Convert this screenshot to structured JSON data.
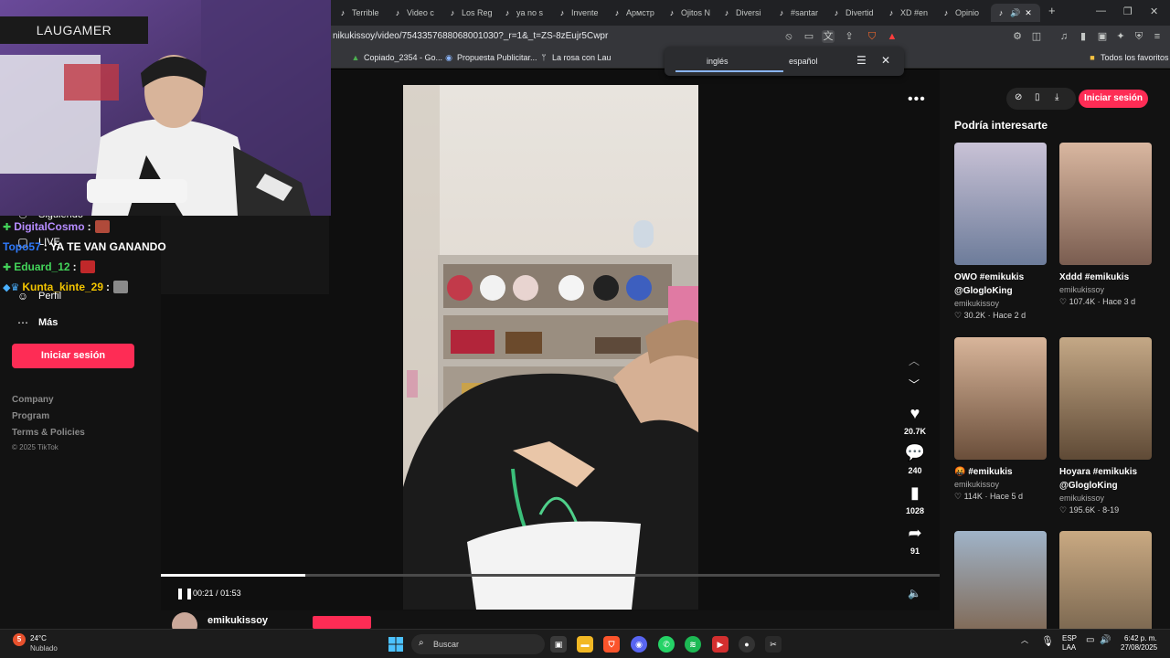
{
  "browser": {
    "tabs": [
      {
        "label": "Terrible"
      },
      {
        "label": "Video c"
      },
      {
        "label": "Los Reg"
      },
      {
        "label": "ya no s"
      },
      {
        "label": "Invente"
      },
      {
        "label": "Армстр"
      },
      {
        "label": "Ojitos N"
      },
      {
        "label": "Diversi"
      },
      {
        "label": "#santar"
      },
      {
        "label": "Divertid"
      },
      {
        "label": "XD #en"
      },
      {
        "label": "Opinio"
      }
    ],
    "new_tab_label": "+",
    "url": "nikukissoy/video/7543357688068001030?_r=1&_t=ZS-8zEujr5Cwpr",
    "bookmarks": [
      {
        "label": "Copiado_2354 - Go..."
      },
      {
        "label": "Propuesta Publicitar..."
      },
      {
        "label": "La rosa con Lau"
      }
    ],
    "bookmarks_right": "Todos los favoritos",
    "translate": {
      "option_1": "inglés",
      "option_2": "español"
    }
  },
  "overlay": {
    "cam_label": "LAUGAMER",
    "chat": [
      {
        "user": "DigitalCosmo",
        "sep": ":",
        "msg": "",
        "badge": "✚",
        "user_color": "#b68cff",
        "badge_color": "#43d45a"
      },
      {
        "user": "Topo57",
        "sep": ":",
        "msg": "YA TE VAN GANANDO",
        "badge": "",
        "user_color": "#2f7bff",
        "badge_color": "#ffffff"
      },
      {
        "user": "Eduard_12",
        "sep": ":",
        "msg": "",
        "badge": "✚",
        "user_color": "#43d45a",
        "badge_color": "#43d45a"
      },
      {
        "user": "Kunta_kinte_29",
        "sep": ":",
        "msg": "",
        "badge": "◆♛",
        "user_color": "#f2c400",
        "badge_color": "#4ab0ff"
      }
    ]
  },
  "leftnav": {
    "items": [
      {
        "label": "Siguiendo"
      },
      {
        "label": "LIVE"
      },
      {
        "label": "Perfil"
      },
      {
        "label": "Más"
      }
    ],
    "login_button": "Iniciar sesión",
    "footer": [
      "Company",
      "Program",
      "Terms & Policies"
    ],
    "copyright": "© 2025 TikTok"
  },
  "player": {
    "more_label": "•••",
    "likes": "20.7K",
    "comments": "240",
    "saves": "1028",
    "shares": "91",
    "time_current": "00:21",
    "time_total": "01:53",
    "time_separator": "/",
    "progress_fraction": 0.1858,
    "author": "emikukissoy"
  },
  "rightcol": {
    "login_button": "Iniciar sesión",
    "title": "Podría interesarte",
    "cards": [
      {
        "title": "OWO #emikukis @GlogloKing",
        "author": "emikukissoy",
        "likes": "30.2K",
        "date": "Hace 2 d",
        "thumb_a": "#c9c2d6",
        "thumb_b": "#6d7c9a"
      },
      {
        "title": "Xddd #emikukis",
        "author": "emikukissoy",
        "likes": "107.4K",
        "date": "Hace 3 d",
        "thumb_a": "#d9b7a0",
        "thumb_b": "#7a5d50"
      },
      {
        "title": "🤬 #emikukis",
        "author": "emikukissoy",
        "likes": "114K",
        "date": "Hace 5 d",
        "thumb_a": "#d8b59a",
        "thumb_b": "#6a4e3a"
      },
      {
        "title": "Hoyara #emikukis @GlogloKing",
        "author": "emikukissoy",
        "likes": "195.6K",
        "date": "8-19",
        "thumb_a": "#c4a886",
        "thumb_b": "#5f4a36"
      },
      {
        "title": "",
        "author": "",
        "likes": "",
        "date": "",
        "thumb_a": "#9fb3c8",
        "thumb_b": "#7a5a3e"
      },
      {
        "title": "",
        "author": "",
        "likes": "",
        "date": "",
        "thumb_a": "#c9a982",
        "thumb_b": "#6b5a46"
      }
    ]
  },
  "taskbar": {
    "weather_badge": "5",
    "temp": "24°C",
    "weather": "Nublado",
    "search_placeholder": "Buscar",
    "lang_1": "ESP",
    "lang_2": "LAA",
    "time": "6:42 p. m.",
    "date": "27/08/2025"
  },
  "colors": {
    "accent": "#fe2c55",
    "page_bg": "#121212"
  }
}
